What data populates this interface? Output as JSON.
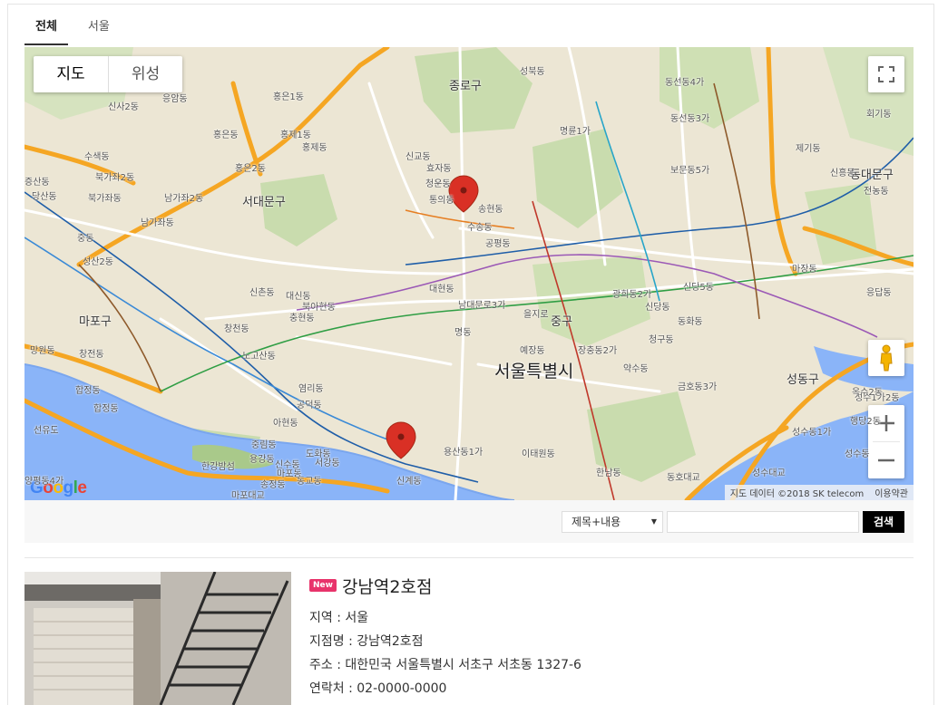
{
  "tabs": [
    {
      "label": "전체",
      "active": true
    },
    {
      "label": "서울",
      "active": false
    }
  ],
  "map": {
    "type_buttons": {
      "map": "지도",
      "satellite": "위성"
    },
    "logo": "Google",
    "attribution": "지도 데이터 ©2018 SK telecom",
    "terms": "이용약관",
    "city_label": "서울특별시",
    "labels": [
      "종로구",
      "성북동",
      "동선동4가",
      "신사2동",
      "홍은1동",
      "응암동",
      "홍제1동",
      "신교동",
      "명륜1가",
      "회기동",
      "홍은동",
      "홍제동",
      "효자동",
      "동선동3가",
      "제기동",
      "수색동",
      "북가좌2동",
      "홍은2동",
      "청운동",
      "보문동5가",
      "증산동",
      "북가좌동",
      "남가좌2동",
      "서대문구",
      "통의동",
      "송현동",
      "동대문구",
      "전농동",
      "남가좌동",
      "수송동",
      "중동",
      "공평동",
      "신흥동",
      "성산2동",
      "신촌동",
      "북아현동",
      "남대문로3가",
      "신당5동",
      "마장동",
      "마포구",
      "대신동",
      "광희동2가",
      "신당동",
      "응답동",
      "충현동",
      "명동",
      "중구",
      "창천동",
      "대현동",
      "을지로",
      "망원동",
      "노고산동",
      "예장동",
      "장충동2가",
      "청구동",
      "서울특별시",
      "약수동",
      "합정동",
      "염리동",
      "금호동3가",
      "성동구",
      "성수1가2동",
      "합정동",
      "공덕동",
      "선유도",
      "용산동1가",
      "이태원동",
      "성수동1가",
      "성수동",
      "한강밤섬",
      "도화동",
      "한남동",
      "동호대교",
      "성수대교",
      "마포대교",
      "신계동",
      "양평동4가",
      "용강동",
      "마포동",
      "동화동",
      "중림동",
      "행당2동",
      "옥수2동",
      "아현동",
      "신수동",
      "창전동",
      "당산동",
      "서강동",
      "동교동",
      "송정동"
    ]
  },
  "search": {
    "select_value": "제목+내용",
    "input_value": "",
    "button_label": "검색"
  },
  "listing": {
    "badge": "New",
    "title": "강남역2호점",
    "fields": [
      "지역 : 서울",
      "지점명 : 강남역2호점",
      "주소 : 대한민국 서울특별시 서초구 서초동 1327-6",
      "연락처 : 02-0000-0000"
    ]
  }
}
